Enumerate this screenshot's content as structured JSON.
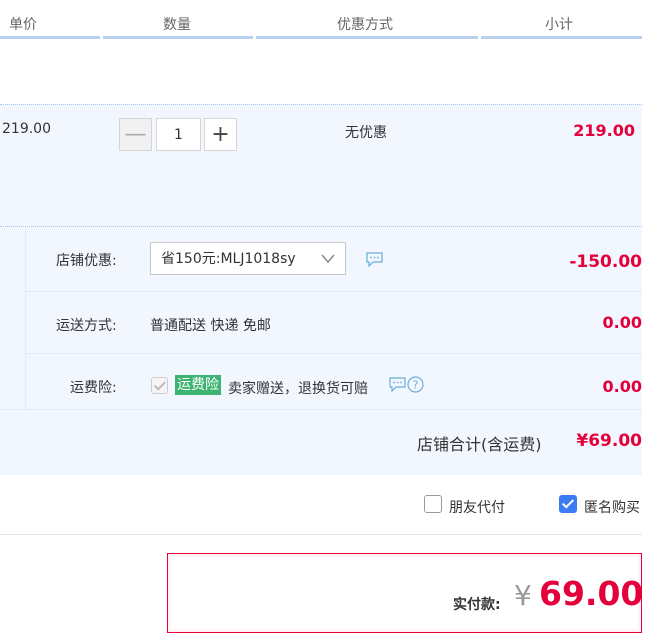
{
  "header": {
    "unit_price": "单价",
    "quantity": "数量",
    "promotion": "优惠方式",
    "subtotal": "小计"
  },
  "item": {
    "unit_price": "219.00",
    "quantity": "1",
    "minus": "—",
    "plus": "+",
    "promotion": "无优惠",
    "subtotal": "219.00"
  },
  "shop": {
    "discount_label": "店铺优惠:",
    "discount_select_value": "省150元:MLJ1018sy",
    "discount_amount": "-150.00",
    "shipping_label": "运送方式:",
    "shipping_value": "普通配送 快递 免邮",
    "shipping_amount": "0.00",
    "insurance_label": "运费险:",
    "insurance_tag": "运费险",
    "insurance_desc": "卖家赠送，退换货可赔",
    "insurance_amount": "0.00",
    "total_label": "店铺合计(含运费)",
    "total_amount": "¥69.00"
  },
  "options": {
    "friend_pay": "朋友代付",
    "anonymous": "匿名购买"
  },
  "payment": {
    "label": "实付款:",
    "currency": "¥",
    "amount": "69.00"
  },
  "icons": {
    "chevron": "chevron-down-icon",
    "message": "message-icon",
    "help": "help-icon"
  },
  "colors": {
    "accent_red": "#e4003a",
    "header_bar": "#b8d0ee",
    "section_bg": "#f2f7ff",
    "checkbox_blue": "#3b7cf5",
    "tag_green": "#3cb371"
  }
}
